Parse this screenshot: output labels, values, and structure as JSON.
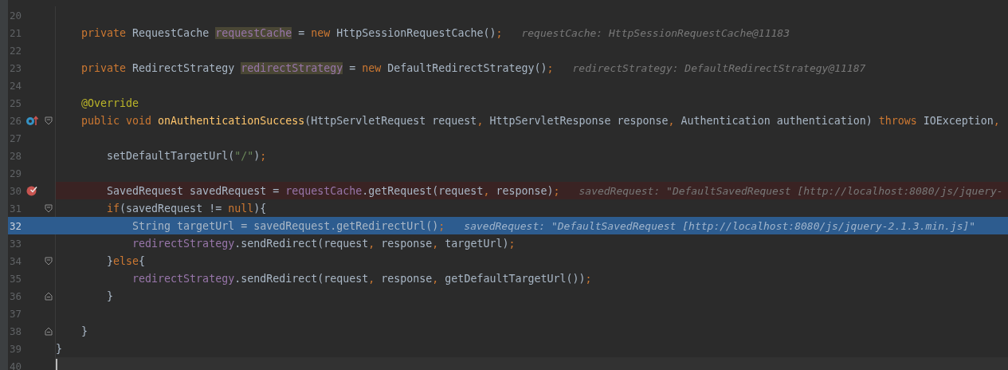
{
  "editor": {
    "lines": [
      {
        "number": "20",
        "override": false,
        "breakpoint": false,
        "execution_point": false,
        "caret": false,
        "fold_start": false,
        "fold_end": false
      },
      {
        "number": "21",
        "override": false,
        "breakpoint": false,
        "execution_point": false,
        "caret": false,
        "fold_start": false,
        "fold_end": false,
        "tokens": [
          {
            "kind": "kw",
            "text": "    private "
          },
          {
            "kind": "plain",
            "text": "RequestCache "
          },
          {
            "kind": "field-marked",
            "text": "requestCache"
          },
          {
            "kind": "plain",
            "text": " = "
          },
          {
            "kind": "kw",
            "text": "new "
          },
          {
            "kind": "plain",
            "text": "HttpSessionRequestCache()"
          },
          {
            "kind": "punct",
            "text": ";"
          }
        ],
        "hint": "requestCache: HttpSessionRequestCache@11183"
      },
      {
        "number": "22",
        "override": false,
        "breakpoint": false,
        "execution_point": false,
        "caret": false,
        "fold_start": false,
        "fold_end": false
      },
      {
        "number": "23",
        "override": false,
        "breakpoint": false,
        "execution_point": false,
        "caret": false,
        "fold_start": false,
        "fold_end": false,
        "tokens": [
          {
            "kind": "kw",
            "text": "    private "
          },
          {
            "kind": "plain",
            "text": "RedirectStrategy "
          },
          {
            "kind": "field-marked",
            "text": "redirectStrategy"
          },
          {
            "kind": "plain",
            "text": " = "
          },
          {
            "kind": "kw",
            "text": "new "
          },
          {
            "kind": "plain",
            "text": "DefaultRedirectStrategy()"
          },
          {
            "kind": "punct",
            "text": ";"
          }
        ],
        "hint": "redirectStrategy: DefaultRedirectStrategy@11187"
      },
      {
        "number": "24",
        "override": false,
        "breakpoint": false,
        "execution_point": false,
        "caret": false,
        "fold_start": false,
        "fold_end": false
      },
      {
        "number": "25",
        "override": false,
        "breakpoint": false,
        "execution_point": false,
        "caret": false,
        "fold_start": false,
        "fold_end": false,
        "tokens": [
          {
            "kind": "annot",
            "text": "    @Override"
          }
        ]
      },
      {
        "number": "26",
        "override": true,
        "breakpoint": false,
        "execution_point": false,
        "caret": false,
        "fold_start": true,
        "fold_end": false,
        "tokens": [
          {
            "kind": "kw",
            "text": "    public void "
          },
          {
            "kind": "method",
            "text": "onAuthenticationSuccess"
          },
          {
            "kind": "plain",
            "text": "(HttpServletRequest request"
          },
          {
            "kind": "punct",
            "text": ", "
          },
          {
            "kind": "plain",
            "text": "HttpServletResponse response"
          },
          {
            "kind": "punct",
            "text": ", "
          },
          {
            "kind": "plain",
            "text": "Authentication authentication) "
          },
          {
            "kind": "kw",
            "text": "throws "
          },
          {
            "kind": "plain",
            "text": "IOException"
          },
          {
            "kind": "punct",
            "text": ","
          }
        ]
      },
      {
        "number": "27",
        "override": false,
        "breakpoint": false,
        "execution_point": false,
        "caret": false,
        "fold_start": false,
        "fold_end": false
      },
      {
        "number": "28",
        "override": false,
        "breakpoint": false,
        "execution_point": false,
        "caret": false,
        "fold_start": false,
        "fold_end": false,
        "tokens": [
          {
            "kind": "plain",
            "text": "        setDefaultTargetUrl("
          },
          {
            "kind": "string",
            "text": "\"/\""
          },
          {
            "kind": "plain",
            "text": ")"
          },
          {
            "kind": "punct",
            "text": ";"
          }
        ]
      },
      {
        "number": "29",
        "override": false,
        "breakpoint": false,
        "execution_point": false,
        "caret": false,
        "fold_start": false,
        "fold_end": false
      },
      {
        "number": "30",
        "override": false,
        "breakpoint": true,
        "execution_point": false,
        "caret": false,
        "fold_start": false,
        "fold_end": false,
        "tokens": [
          {
            "kind": "plain",
            "text": "        SavedRequest savedRequest = "
          },
          {
            "kind": "field",
            "text": "requestCache"
          },
          {
            "kind": "plain",
            "text": ".getRequest(request"
          },
          {
            "kind": "punct",
            "text": ", "
          },
          {
            "kind": "plain",
            "text": "response)"
          },
          {
            "kind": "punct",
            "text": ";"
          }
        ],
        "hint": "savedRequest: \"DefaultSavedRequest [http://localhost:8080/js/jquery-"
      },
      {
        "number": "31",
        "override": false,
        "breakpoint": false,
        "execution_point": false,
        "caret": false,
        "fold_start": true,
        "fold_end": false,
        "tokens": [
          {
            "kind": "kw",
            "text": "        if"
          },
          {
            "kind": "plain",
            "text": "(savedRequest != "
          },
          {
            "kind": "kw",
            "text": "null"
          },
          {
            "kind": "plain",
            "text": "){"
          }
        ]
      },
      {
        "number": "32",
        "override": false,
        "breakpoint": false,
        "execution_point": true,
        "caret": false,
        "fold_start": false,
        "fold_end": false,
        "tokens": [
          {
            "kind": "plain",
            "text": "            String targetUrl = savedRequest.getRedirectUrl()"
          },
          {
            "kind": "punct",
            "text": ";"
          }
        ],
        "hint": "savedRequest: \"DefaultSavedRequest [http://localhost:8080/js/jquery-2.1.3.min.js]\""
      },
      {
        "number": "33",
        "override": false,
        "breakpoint": false,
        "execution_point": false,
        "caret": false,
        "fold_start": false,
        "fold_end": false,
        "tokens": [
          {
            "kind": "field",
            "text": "            redirectStrategy"
          },
          {
            "kind": "plain",
            "text": ".sendRedirect(request"
          },
          {
            "kind": "punct",
            "text": ", "
          },
          {
            "kind": "plain",
            "text": "response"
          },
          {
            "kind": "punct",
            "text": ", "
          },
          {
            "kind": "plain",
            "text": "targetUrl)"
          },
          {
            "kind": "punct",
            "text": ";"
          }
        ]
      },
      {
        "number": "34",
        "override": false,
        "breakpoint": false,
        "execution_point": false,
        "caret": false,
        "fold_start": true,
        "fold_end": false,
        "tokens": [
          {
            "kind": "plain",
            "text": "        }"
          },
          {
            "kind": "kw",
            "text": "else"
          },
          {
            "kind": "plain",
            "text": "{"
          }
        ]
      },
      {
        "number": "35",
        "override": false,
        "breakpoint": false,
        "execution_point": false,
        "caret": false,
        "fold_start": false,
        "fold_end": false,
        "tokens": [
          {
            "kind": "field",
            "text": "            redirectStrategy"
          },
          {
            "kind": "plain",
            "text": ".sendRedirect(request"
          },
          {
            "kind": "punct",
            "text": ", "
          },
          {
            "kind": "plain",
            "text": "response"
          },
          {
            "kind": "punct",
            "text": ", "
          },
          {
            "kind": "plain",
            "text": "getDefaultTargetUrl())"
          },
          {
            "kind": "punct",
            "text": ";"
          }
        ]
      },
      {
        "number": "36",
        "override": false,
        "breakpoint": false,
        "execution_point": false,
        "caret": false,
        "fold_start": false,
        "fold_end": true,
        "tokens": [
          {
            "kind": "plain",
            "text": "        }"
          }
        ]
      },
      {
        "number": "37",
        "override": false,
        "breakpoint": false,
        "execution_point": false,
        "caret": false,
        "fold_start": false,
        "fold_end": false
      },
      {
        "number": "38",
        "override": false,
        "breakpoint": false,
        "execution_point": false,
        "caret": false,
        "fold_start": false,
        "fold_end": true,
        "tokens": [
          {
            "kind": "plain",
            "text": "    }"
          }
        ]
      },
      {
        "number": "39",
        "override": false,
        "breakpoint": false,
        "execution_point": false,
        "caret": false,
        "fold_start": false,
        "fold_end": false,
        "tokens": [
          {
            "kind": "plain",
            "text": "}"
          }
        ]
      },
      {
        "number": "40",
        "override": false,
        "breakpoint": false,
        "execution_point": false,
        "caret": true,
        "fold_start": false,
        "fold_end": false
      }
    ]
  }
}
